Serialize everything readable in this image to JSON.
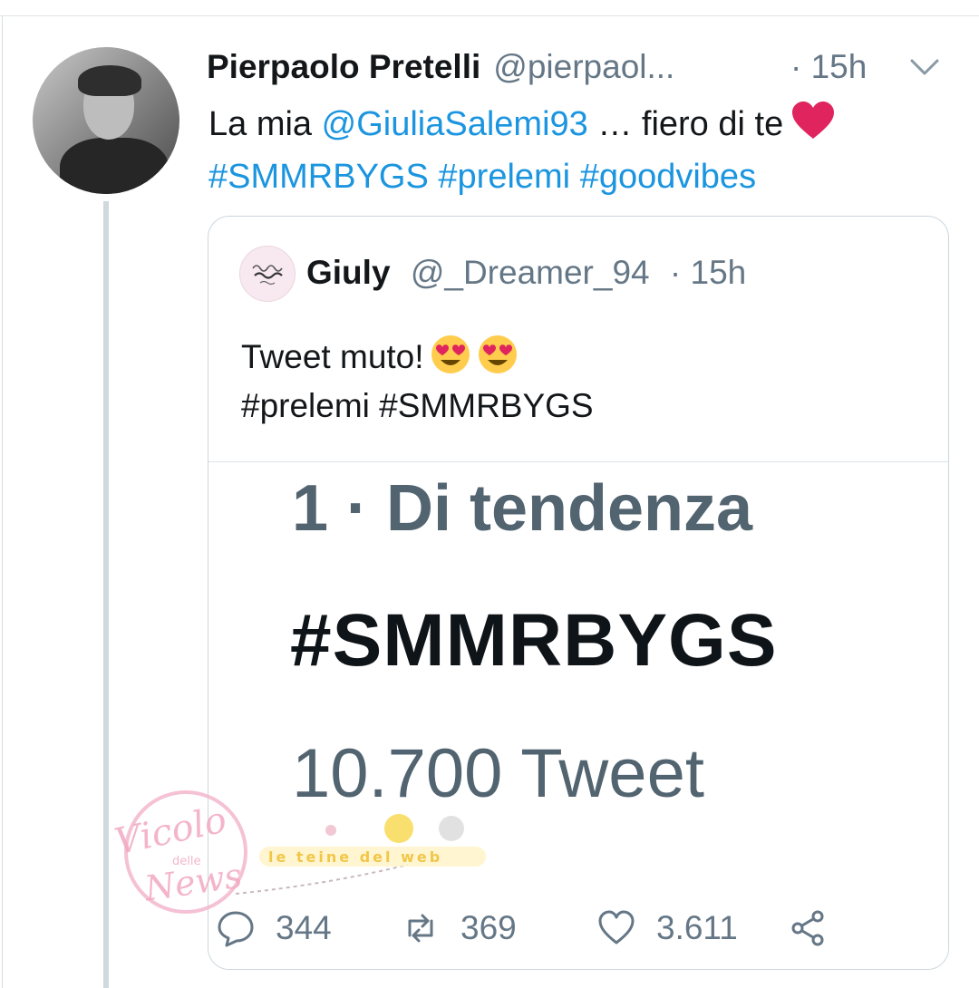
{
  "tweet": {
    "author_name": "Pierpaolo Pretelli",
    "handle": "@pierpaol...",
    "time": "· 15h",
    "text_line1_prefix": "La mia ",
    "mention": "@GiuliaSalemi93",
    "text_line1_suffix": " … fiero di te",
    "hashtag1": "#SMMRBYGS",
    "hashtag2": "#prelemi",
    "hashtag3": "#goodvibes",
    "icons": {
      "options": "chevron-down-icon",
      "emoji": "red-heart"
    }
  },
  "quote": {
    "name": "Giuly",
    "handle": "@_Dreamer_94",
    "time": "· 15h",
    "text_line1": "Tweet muto!",
    "text_line2": "#prelemi #SMMRBYGS",
    "emoji": "smiling-face-with-heart-eyes"
  },
  "media": {
    "rank_line": "1 · Di tendenza",
    "hashtag": "#SMMRBYGS",
    "count_line": "10.700 Tweet"
  },
  "actions": {
    "replies": "344",
    "retweets": "369",
    "likes": "3.611"
  },
  "watermark": {
    "logo_text": "Vicolo delle News",
    "strip_text": "le teine del web"
  },
  "colors": {
    "link": "#1b95e0",
    "secondary_text": "#657786",
    "heart": "#e0245e",
    "thread_line": "#cfd9de"
  }
}
